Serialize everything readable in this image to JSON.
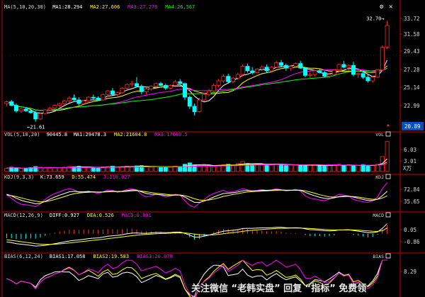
{
  "chart_data": [
    {
      "type": "candlestick",
      "panel": "price",
      "header": {
        "indicator": "MA(5,10,20,30)",
        "series": [
          {
            "name": "MA1",
            "value": "28.294",
            "color": "#ffffff"
          },
          {
            "name": "MA2",
            "value": "27.606",
            "color": "#ffff00"
          },
          {
            "name": "MA3",
            "value": "27.276",
            "color": "#ff00ff"
          },
          {
            "name": "MA4",
            "value": "26.567",
            "color": "#00ff00"
          }
        ]
      },
      "y_ticks": [
        "33.72",
        "31.58",
        "29.43",
        "27.28",
        "25.14",
        "22.99"
      ],
      "ylim": [
        20.8,
        33.9
      ],
      "price_tag": "20.89",
      "annotations": {
        "high": "32.70",
        "low": "21.61"
      },
      "candles": [
        [
          23.6,
          23.9,
          23.3,
          23.8
        ],
        [
          23.8,
          24.0,
          23.3,
          23.4
        ],
        [
          23.4,
          23.6,
          22.6,
          22.8
        ],
        [
          22.8,
          23.1,
          22.6,
          23.0
        ],
        [
          23.0,
          23.2,
          22.7,
          22.8
        ],
        [
          22.8,
          23.0,
          22.5,
          22.6
        ],
        [
          22.6,
          22.8,
          21.6,
          21.9
        ],
        [
          21.9,
          22.6,
          21.8,
          22.5
        ],
        [
          22.5,
          23.0,
          22.4,
          22.9
        ],
        [
          22.9,
          23.2,
          22.8,
          23.1
        ],
        [
          23.1,
          23.5,
          22.9,
          23.4
        ],
        [
          23.4,
          23.7,
          23.2,
          23.6
        ],
        [
          23.6,
          24.0,
          23.4,
          23.9
        ],
        [
          23.9,
          24.4,
          23.7,
          24.2
        ],
        [
          24.2,
          24.6,
          23.9,
          24.0
        ],
        [
          24.0,
          24.3,
          23.4,
          23.6
        ],
        [
          23.6,
          24.0,
          23.5,
          23.9
        ],
        [
          23.9,
          24.4,
          23.8,
          24.3
        ],
        [
          24.3,
          24.6,
          24.0,
          24.2
        ],
        [
          24.2,
          24.4,
          23.9,
          24.0
        ],
        [
          24.0,
          24.7,
          23.9,
          24.6
        ],
        [
          24.6,
          25.1,
          24.4,
          25.0
        ],
        [
          25.0,
          25.3,
          24.5,
          24.6
        ],
        [
          24.6,
          24.9,
          24.3,
          24.8
        ],
        [
          24.8,
          25.4,
          24.7,
          25.3
        ],
        [
          25.3,
          25.8,
          25.1,
          25.7
        ],
        [
          25.7,
          26.1,
          25.5,
          25.8
        ],
        [
          25.8,
          26.5,
          25.4,
          25.5
        ],
        [
          25.5,
          25.7,
          24.6,
          24.9
        ],
        [
          24.9,
          25.4,
          24.6,
          25.2
        ],
        [
          25.2,
          25.6,
          25.0,
          25.5
        ],
        [
          25.5,
          25.9,
          25.3,
          25.8
        ],
        [
          25.8,
          26.0,
          25.5,
          25.6
        ],
        [
          25.6,
          25.8,
          25.1,
          25.3
        ],
        [
          25.3,
          25.7,
          25.2,
          25.6
        ],
        [
          25.6,
          26.2,
          25.4,
          26.0
        ],
        [
          26.0,
          26.3,
          25.6,
          25.8
        ],
        [
          25.8,
          25.9,
          24.0,
          24.3
        ],
        [
          24.3,
          24.5,
          23.0,
          23.3
        ],
        [
          23.3,
          23.6,
          22.3,
          22.7
        ],
        [
          22.7,
          24.2,
          22.6,
          24.0
        ],
        [
          24.0,
          24.8,
          23.8,
          24.6
        ],
        [
          24.6,
          25.2,
          24.4,
          25.0
        ],
        [
          25.0,
          25.8,
          24.8,
          25.6
        ],
        [
          25.6,
          26.3,
          25.4,
          26.1
        ],
        [
          26.1,
          26.8,
          25.9,
          26.6
        ],
        [
          26.6,
          26.9,
          25.8,
          26.0
        ],
        [
          26.0,
          26.5,
          25.8,
          26.4
        ],
        [
          26.4,
          27.0,
          26.2,
          26.8
        ],
        [
          26.8,
          27.9,
          26.6,
          27.7
        ],
        [
          27.7,
          28.0,
          27.0,
          27.2
        ],
        [
          27.2,
          27.6,
          26.8,
          27.0
        ],
        [
          27.0,
          27.5,
          26.9,
          27.4
        ],
        [
          27.4,
          27.8,
          27.2,
          27.6
        ],
        [
          27.6,
          27.9,
          27.0,
          27.2
        ],
        [
          27.2,
          27.7,
          27.0,
          27.6
        ],
        [
          27.6,
          28.3,
          27.5,
          28.1
        ],
        [
          28.1,
          28.4,
          27.7,
          27.8
        ],
        [
          27.8,
          28.0,
          27.2,
          27.5
        ],
        [
          27.5,
          27.8,
          27.2,
          27.7
        ],
        [
          27.7,
          28.1,
          27.5,
          28.0
        ],
        [
          28.0,
          28.3,
          27.4,
          27.5
        ],
        [
          27.5,
          27.6,
          26.5,
          26.7
        ],
        [
          26.7,
          27.0,
          26.4,
          26.8
        ],
        [
          26.8,
          27.3,
          26.6,
          27.2
        ],
        [
          27.2,
          27.4,
          26.9,
          27.0
        ],
        [
          27.0,
          27.2,
          26.5,
          26.6
        ],
        [
          26.6,
          26.9,
          26.4,
          26.8
        ],
        [
          26.8,
          27.4,
          26.7,
          27.3
        ],
        [
          27.3,
          28.0,
          27.1,
          27.9
        ],
        [
          27.9,
          28.3,
          27.5,
          27.6
        ],
        [
          27.6,
          27.9,
          27.2,
          27.8
        ],
        [
          27.8,
          28.2,
          26.6,
          26.8
        ],
        [
          26.8,
          27.0,
          26.4,
          26.9
        ],
        [
          26.9,
          27.2,
          26.3,
          26.5
        ],
        [
          26.5,
          26.8,
          25.9,
          26.1
        ],
        [
          26.1,
          26.6,
          25.9,
          26.5
        ],
        [
          26.5,
          27.4,
          26.4,
          27.3
        ],
        [
          27.3,
          30.0,
          27.2,
          29.8
        ],
        [
          29.8,
          32.7,
          29.6,
          32.2
        ]
      ]
    },
    {
      "type": "bar",
      "panel": "volume",
      "header": {
        "indicator": "VOL(5,10,20)",
        "value": "90445.8",
        "series": [
          {
            "name": "MA1",
            "value": "29478.3",
            "color": "#ffffff"
          },
          {
            "name": "MA2",
            "value": "21604.8",
            "color": "#ffff00"
          },
          {
            "name": "MA3",
            "value": "17660.5",
            "color": "#ff00ff"
          }
        ]
      },
      "y_ticks": [
        "6.03",
        "3.01"
      ],
      "unit": "X万",
      "ylim": [
        0,
        9.8
      ],
      "values": [
        1.0,
        1.3,
        1.1,
        0.9,
        1.0,
        1.2,
        1.5,
        1.3,
        1.1,
        1.0,
        1.2,
        1.1,
        1.3,
        1.5,
        1.4,
        1.6,
        1.2,
        1.3,
        1.1,
        1.0,
        1.4,
        1.5,
        1.6,
        1.3,
        1.4,
        1.6,
        1.5,
        1.7,
        1.8,
        1.4,
        1.3,
        1.5,
        1.2,
        1.4,
        1.3,
        1.6,
        1.5,
        2.2,
        2.6,
        2.0,
        1.8,
        1.9,
        1.7,
        1.6,
        1.8,
        2.0,
        2.2,
        1.9,
        2.4,
        3.0,
        2.4,
        2.1,
        2.0,
        2.2,
        1.9,
        2.1,
        2.3,
        2.0,
        1.8,
        2.1,
        1.9,
        2.0,
        1.7,
        1.9,
        2.0,
        1.8,
        1.6,
        1.9,
        2.1,
        2.2,
        1.8,
        2.0,
        1.7,
        1.8,
        2.1,
        1.6,
        1.9,
        2.2,
        4.5,
        9.0
      ]
    },
    {
      "type": "line",
      "panel": "kdj",
      "header": {
        "indicator": "KDJ(9,3,3)",
        "series": [
          {
            "name": "K",
            "value": "73.659",
            "color": "#ffffff"
          },
          {
            "name": "D",
            "value": "55.474",
            "color": "#ffff00"
          },
          {
            "name": "J",
            "value": "110.027",
            "color": "#ff00ff"
          }
        ]
      },
      "y_ticks": [
        "72.84",
        "35.65"
      ],
      "ylim": [
        0,
        115
      ],
      "J": [
        60,
        45,
        30,
        20,
        18,
        15,
        10,
        22,
        40,
        55,
        65,
        72,
        80,
        85,
        80,
        70,
        72,
        75,
        70,
        65,
        72,
        80,
        78,
        70,
        75,
        82,
        85,
        80,
        60,
        50,
        55,
        62,
        58,
        50,
        55,
        62,
        58,
        35,
        15,
        8,
        25,
        40,
        55,
        65,
        72,
        78,
        70,
        72,
        78,
        85,
        80,
        75,
        78,
        82,
        78,
        80,
        85,
        80,
        75,
        78,
        82,
        75,
        55,
        45,
        42,
        38,
        35,
        42,
        52,
        62,
        58,
        55,
        40,
        35,
        30,
        28,
        35,
        50,
        85,
        110
      ],
      "K": [
        62,
        55,
        45,
        37,
        31,
        27,
        22,
        24,
        32,
        42,
        50,
        58,
        65,
        72,
        74,
        72,
        72,
        73,
        72,
        70,
        71,
        74,
        75,
        73,
        74,
        77,
        80,
        79,
        72,
        65,
        62,
        61,
        60,
        57,
        56,
        58,
        58,
        50,
        38,
        28,
        28,
        33,
        41,
        50,
        58,
        65,
        66,
        68,
        71,
        76,
        77,
        76,
        76,
        78,
        78,
        79,
        81,
        80,
        78,
        78,
        79,
        78,
        70,
        62,
        55,
        49,
        45,
        44,
        47,
        52,
        54,
        54,
        50,
        45,
        40,
        36,
        36,
        41,
        56,
        74
      ],
      "D": [
        58,
        56,
        52,
        47,
        42,
        37,
        33,
        30,
        31,
        35,
        40,
        46,
        52,
        59,
        64,
        67,
        69,
        70,
        71,
        71,
        71,
        72,
        73,
        73,
        73,
        74,
        76,
        77,
        75,
        72,
        69,
        66,
        64,
        62,
        60,
        59,
        59,
        56,
        50,
        43,
        38,
        36,
        38,
        42,
        47,
        53,
        57,
        61,
        64,
        68,
        71,
        73,
        74,
        75,
        76,
        77,
        78,
        79,
        79,
        79,
        79,
        79,
        76,
        71,
        66,
        60,
        55,
        51,
        50,
        51,
        52,
        53,
        52,
        50,
        47,
        43,
        41,
        41,
        46,
        55
      ]
    },
    {
      "type": "line",
      "panel": "macd",
      "header": {
        "indicator": "MACD(12,26,9)",
        "series": [
          {
            "name": "DIFF",
            "value": "0.927",
            "color": "#ffffff"
          },
          {
            "name": "DEA",
            "value": "0.526",
            "color": "#ffff00"
          },
          {
            "name": "MACD",
            "value": "0.801",
            "color": "#ff00ff"
          }
        ]
      },
      "y_ticks": [
        "0.05",
        "-0.86"
      ],
      "ylim": [
        -1.5,
        1.35
      ],
      "DIFF": [
        -0.75,
        -0.8,
        -0.9,
        -0.95,
        -1.0,
        -1.05,
        -1.12,
        -1.1,
        -1.05,
        -0.98,
        -0.9,
        -0.82,
        -0.74,
        -0.66,
        -0.6,
        -0.56,
        -0.5,
        -0.44,
        -0.4,
        -0.37,
        -0.3,
        -0.22,
        -0.18,
        -0.14,
        -0.08,
        0.0,
        0.06,
        0.08,
        0.05,
        0.05,
        0.08,
        0.12,
        0.12,
        0.1,
        0.12,
        0.16,
        0.16,
        0.05,
        -0.12,
        -0.3,
        -0.3,
        -0.22,
        -0.12,
        0.0,
        0.12,
        0.24,
        0.28,
        0.32,
        0.38,
        0.48,
        0.5,
        0.5,
        0.52,
        0.55,
        0.55,
        0.56,
        0.6,
        0.6,
        0.56,
        0.55,
        0.56,
        0.54,
        0.45,
        0.38,
        0.36,
        0.32,
        0.28,
        0.26,
        0.28,
        0.35,
        0.36,
        0.38,
        0.3,
        0.24,
        0.18,
        0.1,
        0.1,
        0.18,
        0.5,
        0.93
      ],
      "DEA": [
        -0.55,
        -0.6,
        -0.66,
        -0.72,
        -0.78,
        -0.84,
        -0.9,
        -0.94,
        -0.96,
        -0.96,
        -0.95,
        -0.92,
        -0.88,
        -0.84,
        -0.79,
        -0.74,
        -0.69,
        -0.64,
        -0.59,
        -0.55,
        -0.5,
        -0.44,
        -0.39,
        -0.34,
        -0.29,
        -0.23,
        -0.17,
        -0.12,
        -0.08,
        -0.05,
        -0.02,
        0.01,
        0.03,
        0.04,
        0.06,
        0.08,
        0.09,
        0.08,
        0.04,
        -0.03,
        -0.08,
        -0.11,
        -0.11,
        -0.09,
        -0.05,
        0.01,
        0.06,
        0.11,
        0.16,
        0.22,
        0.28,
        0.32,
        0.36,
        0.4,
        0.43,
        0.45,
        0.48,
        0.5,
        0.51,
        0.52,
        0.53,
        0.53,
        0.51,
        0.48,
        0.46,
        0.43,
        0.4,
        0.37,
        0.35,
        0.35,
        0.35,
        0.36,
        0.35,
        0.33,
        0.3,
        0.26,
        0.23,
        0.22,
        0.28,
        0.53
      ]
    },
    {
      "type": "line",
      "panel": "bias",
      "header": {
        "indicator": "BIAS(6,12,24)",
        "series": [
          {
            "name": "BIAS1",
            "value": "17.058",
            "color": "#ffffff"
          },
          {
            "name": "BIAS2",
            "value": "19.583",
            "color": "#ffff00"
          },
          {
            "name": "BIAS3",
            "value": "20.079",
            "color": "#ff00ff"
          }
        ]
      },
      "y_ticks": [
        "8.29"
      ],
      "ylim": [
        -4,
        11
      ]
    }
  ],
  "watermark": "关注微信 “老韩实盘” 回复 “指标” 免费领",
  "icons": [
    "gear-icon",
    "close-icon",
    "gear-icon",
    "close-icon",
    "up-arrow-icon"
  ],
  "colors": {
    "up": "#ff2c2c",
    "down": "#00ffff",
    "axis": "#c8000a",
    "tag_bg": "#0050c8",
    "text": "#d8d8d8"
  }
}
